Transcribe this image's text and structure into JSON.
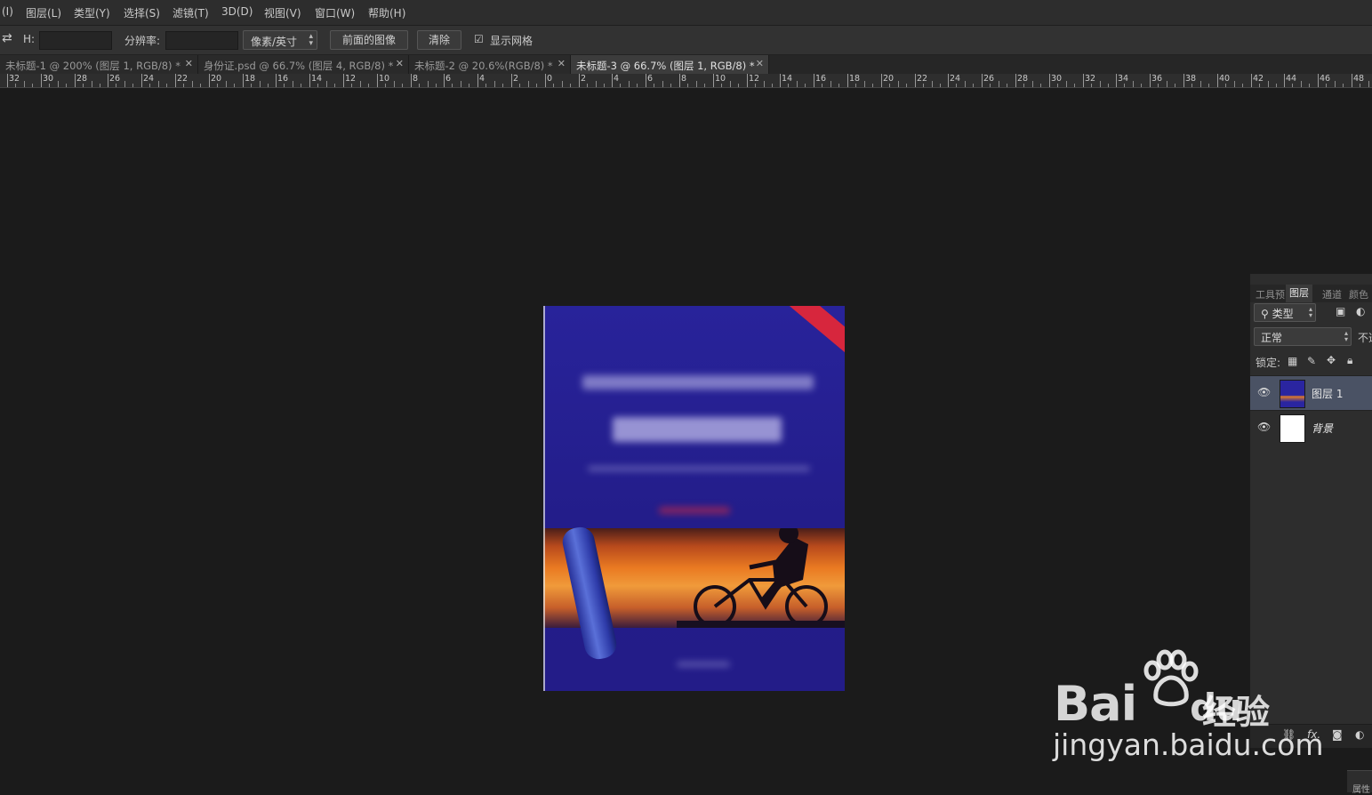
{
  "menu": [
    "(I)",
    "图层(L)",
    "类型(Y)",
    "选择(S)",
    "滤镜(T)",
    "3D(D)",
    "视图(V)",
    "窗口(W)",
    "帮助(H)"
  ],
  "options": {
    "h_label": "H:",
    "resolution_label": "分辨率:",
    "unit_select": "像素/英寸",
    "front_image_button": "前面的图像",
    "clear_button": "清除",
    "show_grid_label": "显示网格",
    "show_grid_checked": true
  },
  "tabs": [
    {
      "title": "未标题-1 @ 200% (图层 1, RGB/8) *",
      "active": false
    },
    {
      "title": "身份证.psd @ 66.7% (图层 4, RGB/8) *",
      "active": false
    },
    {
      "title": "未标题-2 @ 20.6%(RGB/8) *",
      "active": false
    },
    {
      "title": "未标题-3 @ 66.7% (图层 1, RGB/8) *",
      "active": true
    }
  ],
  "ruler_labels": [
    "32",
    "30",
    "28",
    "26",
    "24",
    "22",
    "20",
    "18",
    "16",
    "14",
    "12",
    "10",
    "8",
    "6",
    "4",
    "2",
    "0",
    "2",
    "4",
    "6",
    "8",
    "10",
    "12",
    "14",
    "16",
    "18",
    "20",
    "22",
    "24",
    "26",
    "28",
    "30",
    "32",
    "34",
    "36",
    "38",
    "40",
    "42",
    "44",
    "46",
    "48"
  ],
  "panel": {
    "tabs": [
      "工具预",
      "图层",
      "通道",
      "颜色"
    ],
    "active_tab": "图层",
    "filter_kind": "类型",
    "blend_mode": "正常",
    "opacity_label": "不透",
    "lock_label": "锁定:",
    "layers": [
      {
        "name": "图层 1",
        "selected": true,
        "visible": true
      },
      {
        "name": "背景",
        "selected": false,
        "visible": true
      }
    ]
  },
  "properties_stub": "属性",
  "watermark": {
    "logo": "Bai",
    "logo_suffix": "du",
    "brand": "经验",
    "url": "jingyan.baidu.com"
  }
}
